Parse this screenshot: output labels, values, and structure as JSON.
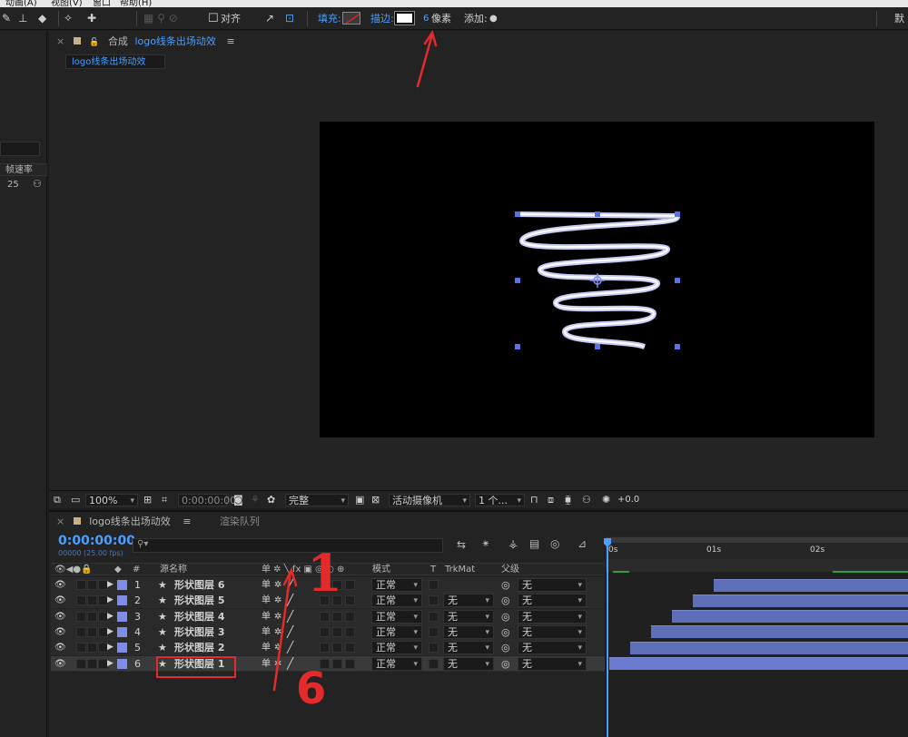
{
  "menu": [
    "动画(A)",
    "视图(V)",
    "窗口",
    "帮助(H)"
  ],
  "toolbar": {
    "align_label": "对齐",
    "fill_label": "填充:",
    "stroke_label": "描边:",
    "stroke_width": "6",
    "stroke_unit": "像素",
    "add_label": "添加:",
    "right_label": "默"
  },
  "left_panel": {
    "column": "帧速率",
    "value": "25"
  },
  "viewer": {
    "tab_prefix": "合成",
    "tab_name": "logo线条出场动效",
    "sub_tab": "logo线条出场动效"
  },
  "viewer_bar": {
    "zoom": "100%",
    "time": "0:00:00:00",
    "quality": "完整",
    "camera": "活动摄像机",
    "views": "1 个...",
    "exposure": "+0.0"
  },
  "timeline": {
    "tab_name": "logo线条出场动效",
    "render_queue": "渲染队列",
    "timecode": "0:00:00:00",
    "fps": "00000 (25.00 fps)",
    "columns": {
      "num": "#",
      "source": "源名称",
      "mode": "模式",
      "t": "T",
      "trkmat": "TrkMat",
      "parent": "父级"
    },
    "ruler": [
      "0s",
      "01s",
      "02s"
    ],
    "layers": [
      {
        "num": "1",
        "name": "形状图层 6",
        "mode": "正常",
        "trkmat": "",
        "parent": "无",
        "bar_start": 0.35
      },
      {
        "num": "2",
        "name": "形状图层 5",
        "mode": "正常",
        "trkmat": "无",
        "parent": "无",
        "bar_start": 0.28
      },
      {
        "num": "3",
        "name": "形状图层 4",
        "mode": "正常",
        "trkmat": "无",
        "parent": "无",
        "bar_start": 0.21
      },
      {
        "num": "4",
        "name": "形状图层 3",
        "mode": "正常",
        "trkmat": "无",
        "parent": "无",
        "bar_start": 0.14
      },
      {
        "num": "5",
        "name": "形状图层 2",
        "mode": "正常",
        "trkmat": "无",
        "parent": "无",
        "bar_start": 0.07
      },
      {
        "num": "6",
        "name": "形状图层 1",
        "mode": "正常",
        "trkmat": "无",
        "parent": "无",
        "bar_start": 0.0
      }
    ]
  },
  "annotations": {
    "mark_one": "1",
    "mark_six": "6"
  },
  "colors": {
    "accent": "#4a9fff",
    "annotation": "#e32b2b",
    "layer_bar": "#5e6fb8",
    "label": "#7f8de8"
  }
}
